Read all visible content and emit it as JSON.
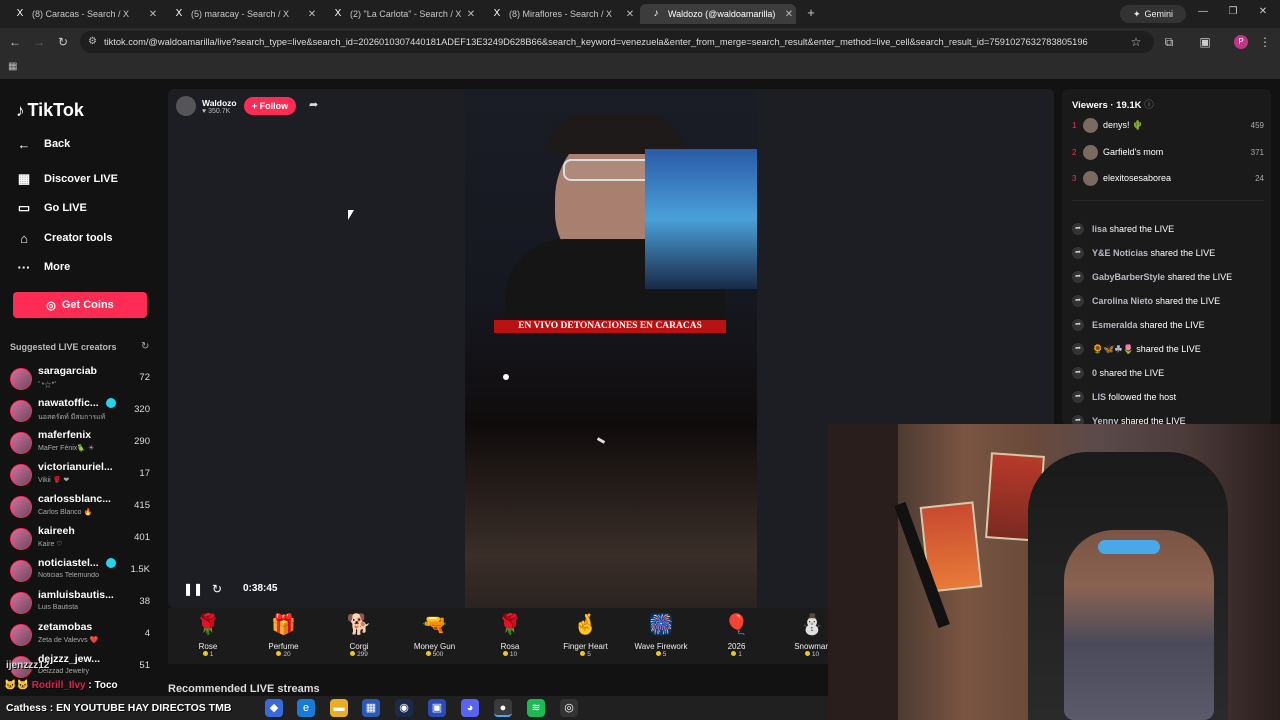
{
  "browser": {
    "tabs": [
      {
        "title": "(8) Caracas - Search / X",
        "icon": "X"
      },
      {
        "title": "(5) maracay - Search / X",
        "icon": "X"
      },
      {
        "title": "(2) \"La Carlota\" - Search / X",
        "icon": "X"
      },
      {
        "title": "(8) Miraflores - Search / X",
        "icon": "X"
      },
      {
        "title": "Waldozo (@waldoamarilla)",
        "icon": "♪"
      }
    ],
    "gemini_label": "Gemini",
    "url": "tiktok.com/@waldoamarilla/live?search_type=live&search_id=2026010307440181ADEF13E3249D628B66&search_keyword=venezuela&enter_from_merge=search_result&enter_method=live_cell&search_result_id=7591027632783805196",
    "profile_initial": "P"
  },
  "tiktok": {
    "logo": "TikTok",
    "nav": {
      "back": "Back",
      "discover": "Discover LIVE",
      "golive": "Go LIVE",
      "creator_tools": "Creator tools",
      "more": "More"
    },
    "get_coins": "Get Coins",
    "suggested_header": "Suggested LIVE creators",
    "creators": [
      {
        "name": "saragarciab",
        "sub": "ﾟ*☆*ﾟ",
        "count": "72"
      },
      {
        "name": "nawatoffic...",
        "sub": "นอสตรัดท์ มีสมการแท้",
        "count": "320",
        "verified": true
      },
      {
        "name": "maferfenix",
        "sub": "MaFer Fénix🦜 ☀",
        "count": "290"
      },
      {
        "name": "victorianuriel...",
        "sub": "Vikii 🌹 ❤",
        "count": "17"
      },
      {
        "name": "carlossblanc...",
        "sub": "Carlos Blanco 🔥",
        "count": "415"
      },
      {
        "name": "kaireeh",
        "sub": "Kaire ♡",
        "count": "401"
      },
      {
        "name": "noticiastel...",
        "sub": "Noticias Telemundo",
        "count": "1.5K",
        "verified": true
      },
      {
        "name": "iamluisbautis...",
        "sub": "Luis Bautista",
        "count": "38"
      },
      {
        "name": "zetamobas",
        "sub": "Zeta de Valevvs ❤️",
        "count": "4"
      },
      {
        "name": "dejzzz_jew...",
        "sub": "Deizzad Jewelry",
        "count": "51"
      }
    ],
    "host": {
      "name": "Waldozo",
      "likes": "350.7K"
    },
    "follow": "+ Follow",
    "banner": "EN VIVO DETONACIONES EN CARACAS",
    "timer": "0:38:45",
    "gifts": [
      {
        "name": "Rose",
        "price": "1",
        "icon": "🌹"
      },
      {
        "name": "Perfume",
        "price": "20",
        "icon": "🎁"
      },
      {
        "name": "Corgi",
        "price": "299",
        "icon": "🐕"
      },
      {
        "name": "Money Gun",
        "price": "500",
        "icon": "🔫"
      },
      {
        "name": "Rosa",
        "price": "10",
        "icon": "🌹"
      },
      {
        "name": "Finger Heart",
        "price": "5",
        "icon": "🤞"
      },
      {
        "name": "Wave Firework",
        "price": "5",
        "icon": "🎆"
      },
      {
        "name": "2026",
        "price": "1",
        "icon": "🎈"
      },
      {
        "name": "Snowman",
        "price": "10",
        "icon": "⛄"
      }
    ],
    "recommended": "Recommended LIVE streams",
    "viewers": {
      "header": "Viewers · 19.1K",
      "top": [
        {
          "rank": "1",
          "name": "denys! 🌵",
          "count": "459"
        },
        {
          "rank": "2",
          "name": "Garfield's mom",
          "count": "371"
        },
        {
          "rank": "3",
          "name": "elexitosesaborea",
          "count": "24"
        }
      ]
    },
    "activity": [
      {
        "user": "lisa",
        "action": "shared the LIVE"
      },
      {
        "user": "Y&E Noticias",
        "action": "shared the LIVE"
      },
      {
        "user": "GabyBarberStyle",
        "action": "shared the LIVE"
      },
      {
        "user": "Carolina Nieto",
        "action": "shared the LIVE"
      },
      {
        "user": "Esmeralda",
        "action": "shared the LIVE"
      },
      {
        "user": "🌻🦋☘🌷",
        "action": "shared the LIVE"
      },
      {
        "user": "0",
        "action": "shared the LIVE"
      },
      {
        "user": "LIS",
        "action": "followed the host"
      },
      {
        "user": "Yenny",
        "action": "shared the LIVE"
      }
    ]
  },
  "overlay": {
    "chat1_user": "Rodrill_Ilvy",
    "chat1_msg": ": Toco",
    "chat2_user": "ijenzzz12",
    "chat2_msg": "",
    "taskbar_text": "Cathess : EN YOUTUBE HAY DIRECTOS TMB"
  }
}
